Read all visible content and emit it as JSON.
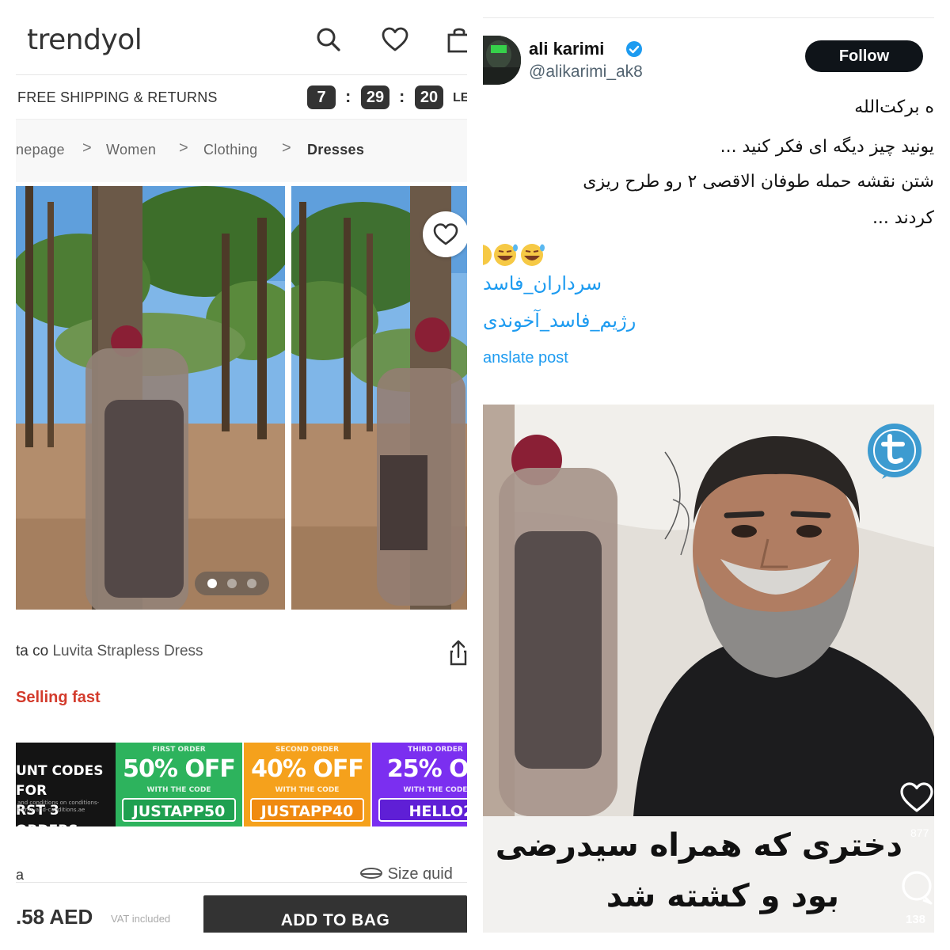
{
  "trendyol": {
    "logo": "trendyol",
    "header_icons": [
      "search-icon",
      "heart-icon",
      "bag-icon"
    ],
    "shipping_text": "FREE SHIPPING & RETURNS",
    "timer": {
      "hours": "7",
      "minutes": "29",
      "seconds": "20",
      "sep": ":",
      "trailing": "LE"
    },
    "breadcrumb": [
      "nepage",
      "Women",
      "Clothing",
      "Dresses"
    ],
    "breadcrumb_sep": ">",
    "gallery": {
      "current_image": 1,
      "image_count": 3
    },
    "product": {
      "brand": "ta co",
      "name": "Luvita Strapless Dress"
    },
    "selling_badge": "Selling fast",
    "promo_banner": {
      "intro": [
        "UNT CODES FOR",
        "RST 3 ORDERS"
      ],
      "intro_fine": "and conditions on\nconditions-terms-and-conditions.ae",
      "offers": [
        {
          "top": "FIRST ORDER",
          "discount": "50% OFF",
          "sub": "WITH THE CODE",
          "code": "JUSTAPP50",
          "color": "#2db35d",
          "code_bg": "#1fa050"
        },
        {
          "top": "SECOND ORDER",
          "discount": "40% OFF",
          "sub": "WITH THE CODE",
          "code": "JUSTAPP40",
          "color": "#f5a11c",
          "code_bg": "#f08a10"
        },
        {
          "top": "THIRD ORDER",
          "discount": "25% OF",
          "sub": "WITH THE CODE",
          "code": "HELLO25",
          "color": "#7b2ff0",
          "code_bg": "#5f1fd6"
        }
      ]
    },
    "size_label": "a",
    "size_guide": "Size guid",
    "price": ".58 AED",
    "vat": "VAT included",
    "add_to_bag": "ADD TO BAG"
  },
  "post": {
    "author_name": "ali karimi",
    "handle": "@alikarimi_ak8",
    "follow_label": "Follow",
    "lines": [
      "ه برکت‌الله",
      "یونید چیز دیگه ای فکر کنید ...",
      "شتن نقشه   حمله طوفان الاقصی ۲ رو طرح ریزی",
      "کردند ..."
    ],
    "emojis": "😅😅😅",
    "hashtags": [
      "سرداران_فاسد",
      "رژیم_فاسد_آخوندی"
    ],
    "translate_label": "anslate post",
    "media": {
      "caption_line1": "دختری که همراه سیدرضی",
      "caption_line2": "بود و کشته شد",
      "like_count": "877",
      "comment_count": "138"
    }
  }
}
